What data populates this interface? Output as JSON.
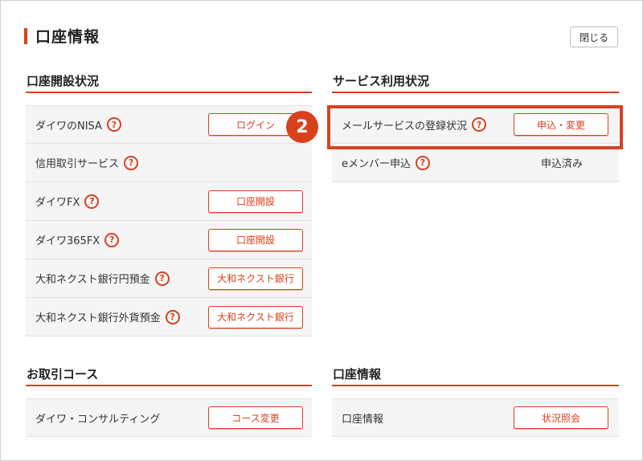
{
  "header": {
    "title": "口座情報",
    "close_label": "閉じる"
  },
  "account_opening": {
    "title": "口座開設状況",
    "rows": [
      {
        "label": "ダイワのNISA",
        "button": "ログイン"
      },
      {
        "label": "信用取引サービス",
        "button": ""
      },
      {
        "label": "ダイワFX",
        "button": "口座開設"
      },
      {
        "label": "ダイワ365FX",
        "button": "口座開設"
      },
      {
        "label": "大和ネクスト銀行円預金",
        "button": "大和ネクスト銀行"
      },
      {
        "label": "大和ネクスト銀行外貨預金",
        "button": "大和ネクスト銀行"
      }
    ]
  },
  "service_usage": {
    "title": "サービス利用状況",
    "rows": [
      {
        "label": "メールサービスの登録状況",
        "button": "申込・変更"
      },
      {
        "label": "eメンバー申込",
        "status": "申込済み"
      }
    ]
  },
  "trading_course": {
    "title": "お取引コース",
    "rows": [
      {
        "label": "ダイワ・コンサルティング",
        "button": "コース変更"
      }
    ]
  },
  "account_info": {
    "title": "口座情報",
    "rows": [
      {
        "label": "口座情報",
        "button": "状況照会"
      }
    ]
  },
  "callout": {
    "number": "2"
  },
  "icons": {
    "help": "question-circle-icon"
  },
  "colors": {
    "accent": "#d9411e"
  }
}
